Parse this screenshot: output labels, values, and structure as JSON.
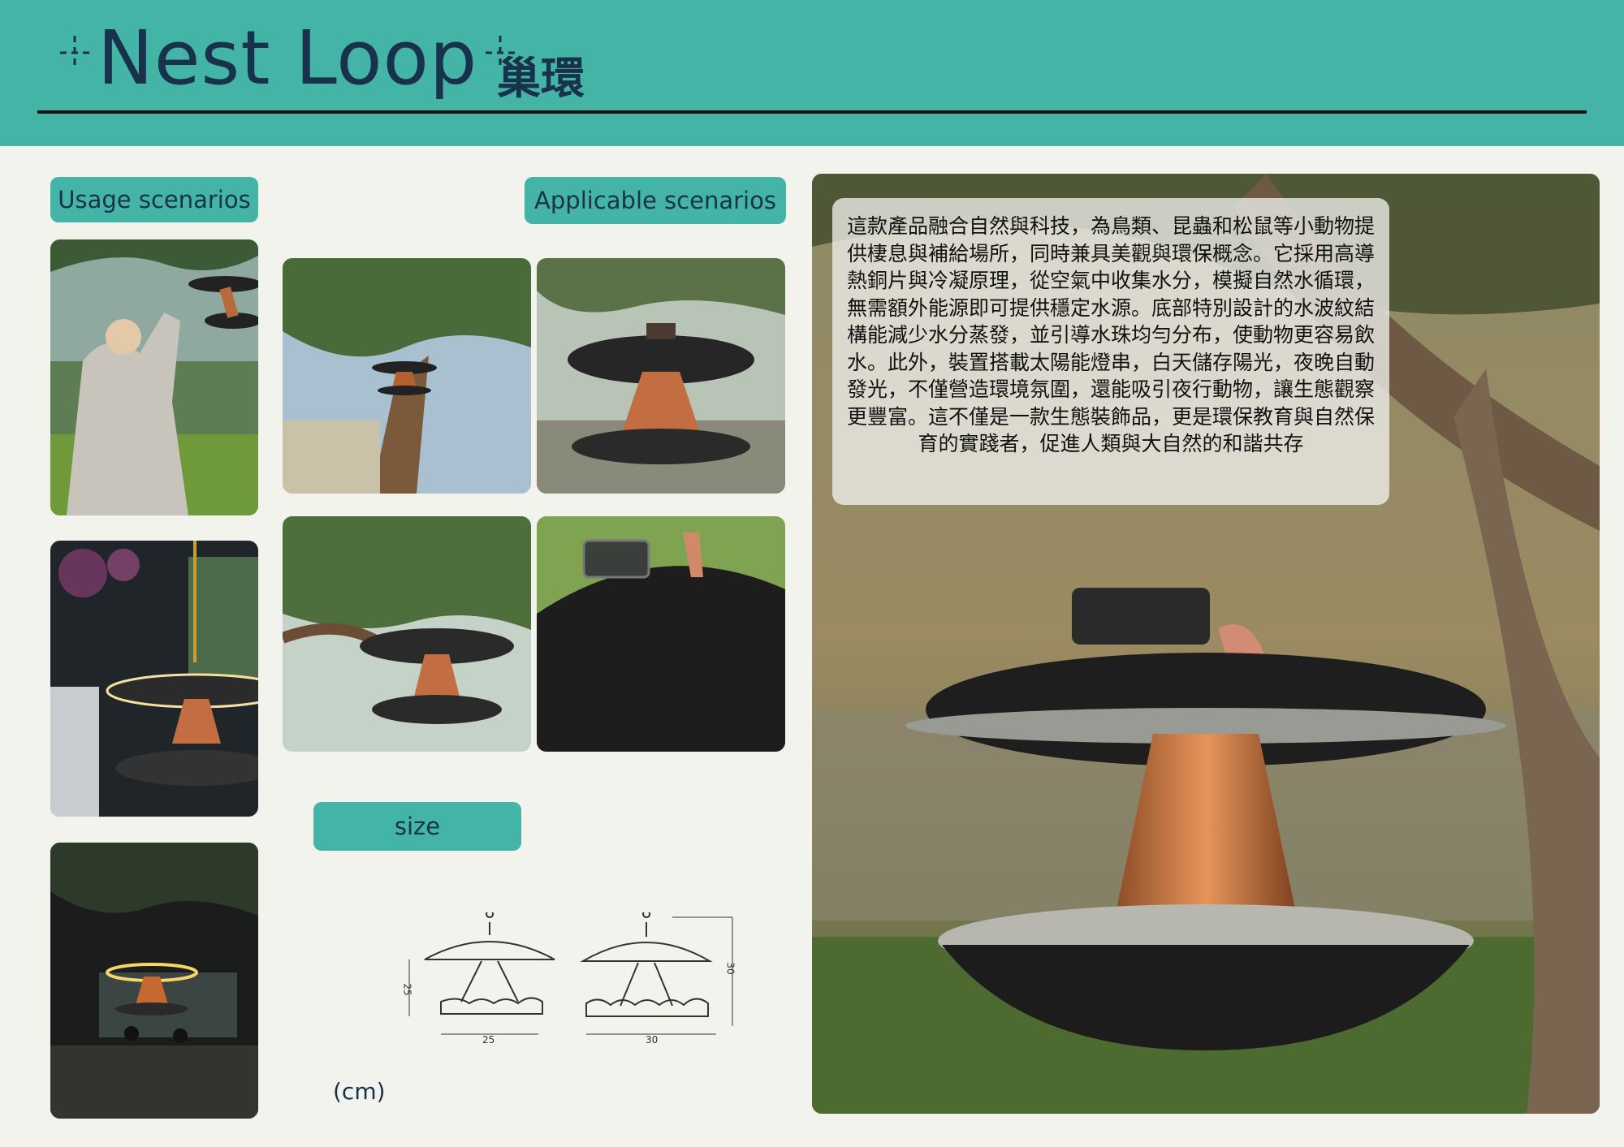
{
  "header": {
    "title": "Nest Loop",
    "spark": "-¦-",
    "subtitle": "巢環"
  },
  "labels": {
    "usage": "Usage scenarios",
    "applicable": "Applicable scenarios",
    "size": "size"
  },
  "description": "這款產品融合自然與科技，為鳥類、昆蟲和松鼠等小動物提供棲息與補給場所，同時兼具美觀與環保概念。它採用高導熱銅片與冷凝原理，從空氣中收集水分，模擬自然水循環，無需額外能源即可提供穩定水源。底部特別設計的水波紋結構能減少水分蒸發，並引導水珠均勻分布，使動物更容易飲水。此外，裝置搭載太陽能燈串，白天儲存陽光，夜晚自動發光，不僅營造環境氛圍，還能吸引夜行動物，讓生態觀察更豐富。這不僅是一款生態裝飾品，更是環保教育與自然保育的實踐者，促進人類與大自然的和諧共存",
  "dimensions": {
    "small_height": "25",
    "small_width": "25",
    "large_height": "30",
    "large_width": "30",
    "unit": "(cm)"
  },
  "colors": {
    "brand": "#44b4a6",
    "ink": "#17324a",
    "background": "#f3f3ee"
  }
}
